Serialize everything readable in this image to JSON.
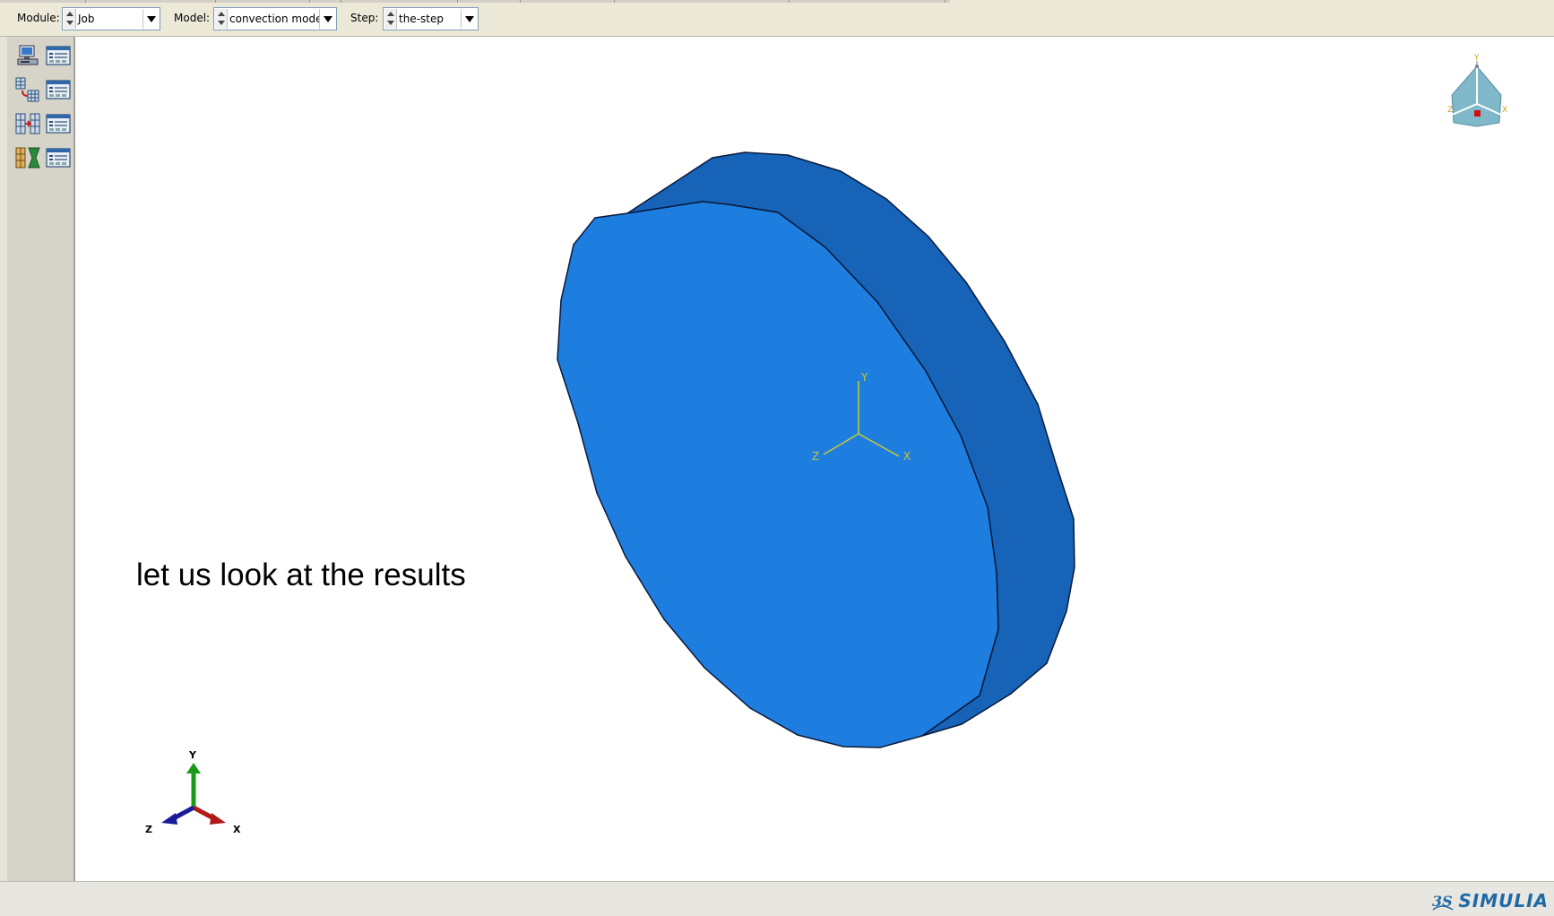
{
  "context_bar": {
    "module": {
      "label": "Module:",
      "value": "Job"
    },
    "model": {
      "label": "Model:",
      "value": "convection model"
    },
    "step": {
      "label": "Step:",
      "value": "the-step"
    }
  },
  "toolbox": {
    "tools": [
      {
        "icon": "job-create-icon"
      },
      {
        "icon": "job-manager-icon"
      },
      {
        "icon": "adaptivity-create-icon"
      },
      {
        "icon": "adaptivity-manager-icon"
      },
      {
        "icon": "co-execution-create-icon"
      },
      {
        "icon": "co-execution-manager-icon"
      },
      {
        "icon": "optimization-create-icon"
      },
      {
        "icon": "optimization-manager-icon"
      }
    ]
  },
  "viewport": {
    "overlay_text": "let us look at the results",
    "model_colors": {
      "face": "#1e7ee0",
      "side": "#1663b8",
      "edge": "#0a1a3a"
    },
    "part_csys": {
      "x": "X",
      "y": "Y",
      "z": "Z",
      "color": "#c8c832"
    },
    "view_triad": {
      "x": "X",
      "y": "Y",
      "z": "Z"
    },
    "view_cube": {
      "x": "X",
      "y": "Y",
      "z": "Z"
    }
  },
  "footer": {
    "brand": "SIMULIA",
    "brand_mark": "3S"
  }
}
